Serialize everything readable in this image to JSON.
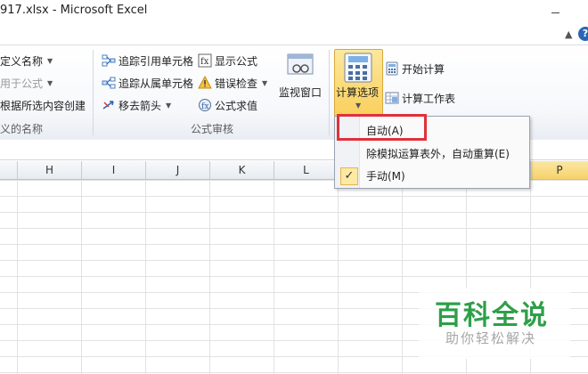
{
  "window": {
    "title": "917.xlsx  -  Microsoft Excel"
  },
  "ribbon": {
    "defined_names": {
      "define_name": "定义名称",
      "use_in_formula": "用于公式",
      "create_from_selection": "根据所选内容创建",
      "group_label": "义的名称"
    },
    "formula_auditing": {
      "trace_precedents": "追踪引用单元格",
      "trace_dependents": "追踪从属单元格",
      "remove_arrows": "移去箭头",
      "show_formulas": "显示公式",
      "error_checking": "错误检查",
      "evaluate_formula": "公式求值",
      "watch_window": "监视窗口",
      "group_label": "公式审核"
    },
    "calculation": {
      "calc_options": "计算选项",
      "calc_now": "开始计算",
      "calc_sheet": "计算工作表"
    }
  },
  "calc_menu": {
    "items": [
      {
        "label": "自动(A)",
        "checked": false
      },
      {
        "label": "除模拟运算表外，自动重算(E)",
        "checked": false
      },
      {
        "label": "手动(M)",
        "checked": true
      }
    ],
    "check_glyph": "✓"
  },
  "sheet": {
    "columns": [
      "H",
      "I",
      "J",
      "K",
      "L",
      "P"
    ]
  },
  "watermark": {
    "main": "百科全说",
    "sub": "助你轻松解决"
  },
  "colors": {
    "accent": "#2a66b4",
    "calc_button": "#f9cf5e",
    "highlight_box": "#e0303a",
    "watermark_green": "#2e9f49"
  }
}
